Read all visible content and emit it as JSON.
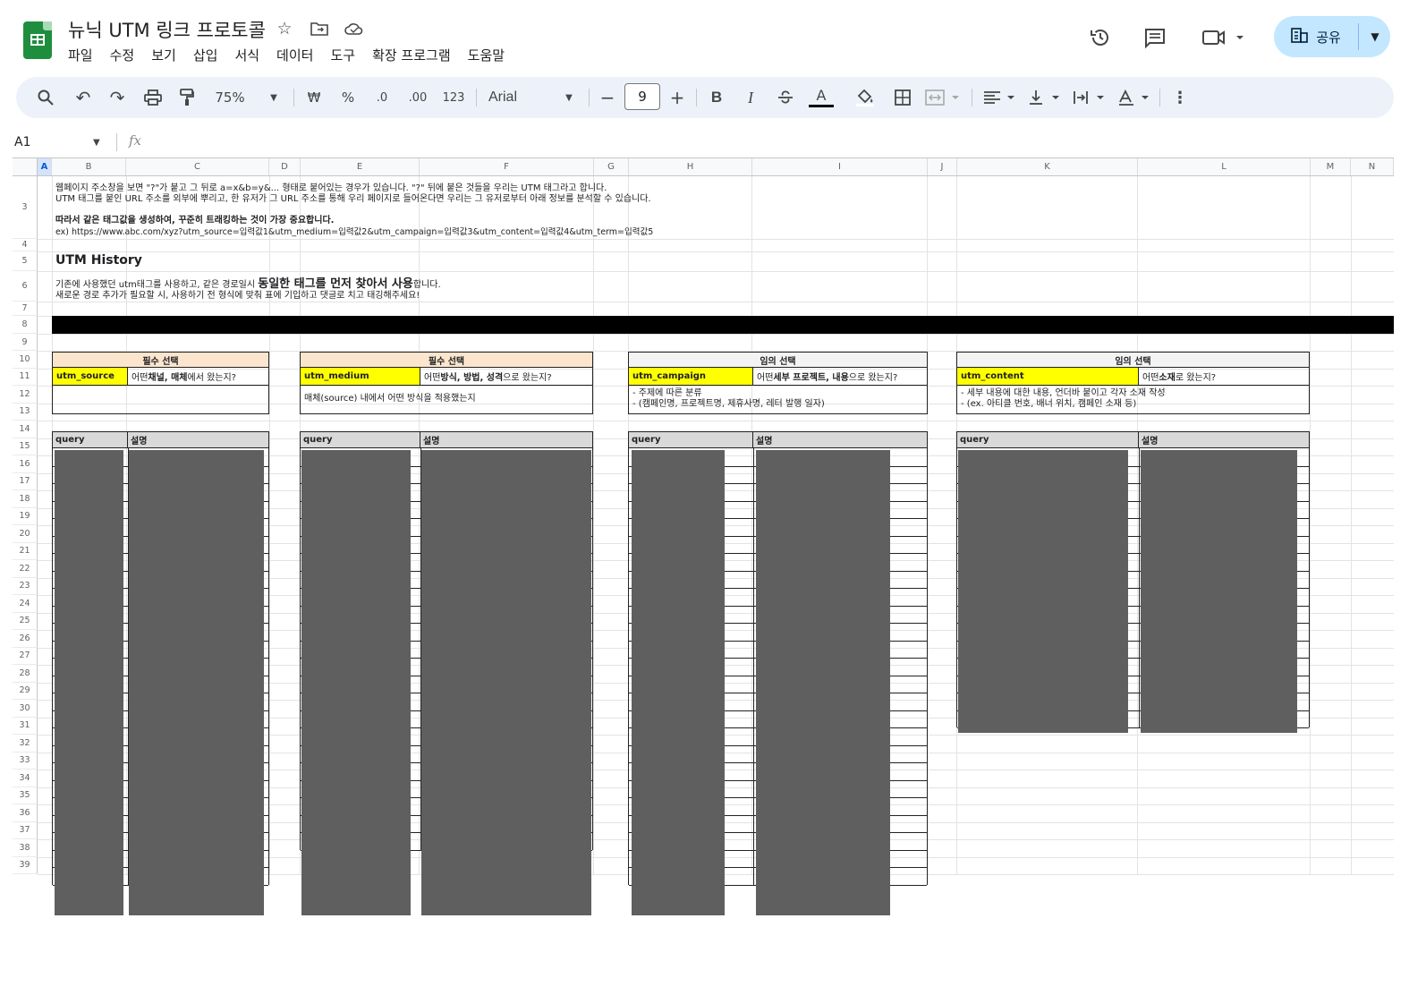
{
  "app": {
    "title": "뉴닉 UTM 링크 프로토콜",
    "menu": [
      "파일",
      "수정",
      "보기",
      "삽입",
      "서식",
      "데이터",
      "도구",
      "확장 프로그램",
      "도움말"
    ],
    "share_label": "공유"
  },
  "toolbar": {
    "zoom": "75%",
    "currency": "₩",
    "percent": "%",
    "dec_decrease": ".0",
    "dec_increase": ".00",
    "number_format": "123",
    "font": "Arial",
    "font_size": "9",
    "bold": "B",
    "italic": "I",
    "text_color_glyph": "A"
  },
  "formula_bar": {
    "cell_ref": "A1",
    "fx": "fx"
  },
  "columns": [
    "A",
    "B",
    "C",
    "D",
    "E",
    "F",
    "G",
    "H",
    "I",
    "J",
    "K",
    "L",
    "M",
    "N"
  ],
  "rows": [
    "3",
    "4",
    "5",
    "6",
    "7",
    "8",
    "9",
    "10",
    "11",
    "12",
    "13",
    "14",
    "15",
    "16",
    "17",
    "18",
    "19",
    "20",
    "21",
    "22",
    "23",
    "24",
    "25",
    "26",
    "27",
    "28",
    "29",
    "30",
    "31",
    "32",
    "33",
    "34",
    "35",
    "36",
    "37",
    "38",
    "39"
  ],
  "intro": {
    "line1": "웹페이지 주소창을 보면 \"?\"가 붙고 그 뒤로 a=x&b=y&... 형태로 붙어있는 경우가 있습니다. \"?\" 뒤에 붙은 것들을 우리는 UTM 태그라고 합니다.",
    "line2": "UTM 태그를 붙인 URL 주소를 외부에 뿌리고, 한 유저가 그 URL 주소를 통해 우리 페이지로 들어온다면 우리는 그 유저로부터 아래 정보를 분석할 수 있습니다.",
    "bold_line": "따라서 같은 태그값을 생성하여, 꾸준히 트래킹하는 것이 가장 중요합니다.",
    "example": "ex) https://www.abc.com/xyz?utm_source=입력값1&utm_medium=입력값2&utm_campaign=입력값3&utm_content=입력값4&utm_term=입력값5"
  },
  "history": {
    "title": "UTM History",
    "line1_pre": "기존에 사용했던 utm태그를 사용하고, 같은 경로일시 ",
    "line1_bold": "동일한 태그를 먼저 찾아서 사용",
    "line1_post": "합니다.",
    "line2": "새로운 경로 추가가 필요할 시, 사용하기 전 형식에 맞춰 표에 기입하고 댓글로 치고 태깅해주세요!"
  },
  "categories": [
    {
      "head": "필수 선택",
      "key": "utm_source",
      "q_pre": "어떤 ",
      "q_bold": "채널, 매체",
      "q_post": "에서 왔는지?",
      "desc1": "",
      "desc2": ""
    },
    {
      "head": "필수 선택",
      "key": "utm_medium",
      "q_pre": "어떤 ",
      "q_bold": "방식, 방법, 성격",
      "q_post": "으로 왔는지?",
      "desc1": "매체(source) 내에서 어떤 방식을 적용했는지",
      "desc2": ""
    },
    {
      "head": "임의 선택",
      "key": "utm_campaign",
      "q_pre": "어떤 ",
      "q_bold": "세부 프로젝트, 내용",
      "q_post": "으로 왔는지?",
      "desc1": "- 주제에 따른 분류",
      "desc2": "- (캠페인명, 프로젝트명, 제휴사명, 레터 발행 일자)"
    },
    {
      "head": "임의 선택",
      "key": "utm_content",
      "q_pre": "어떤 ",
      "q_bold": "소재",
      "q_post": "로 왔는지?",
      "desc1": "- 세부 내용에 대한 내용, 언더바 붙이고 각자 소재 작성",
      "desc2": "- (ex. 아티클 번호, 배너 위치, 캠페인 소재 등)"
    }
  ],
  "table_headers": {
    "query": "query",
    "desc": "설명"
  },
  "colors": {
    "header_orange": "#fce5cd",
    "key_yellow": "#ffff00",
    "redaction": "#5f5f5f",
    "share_blue": "#c2e7ff",
    "toolbar_bg": "#edf2fa"
  }
}
